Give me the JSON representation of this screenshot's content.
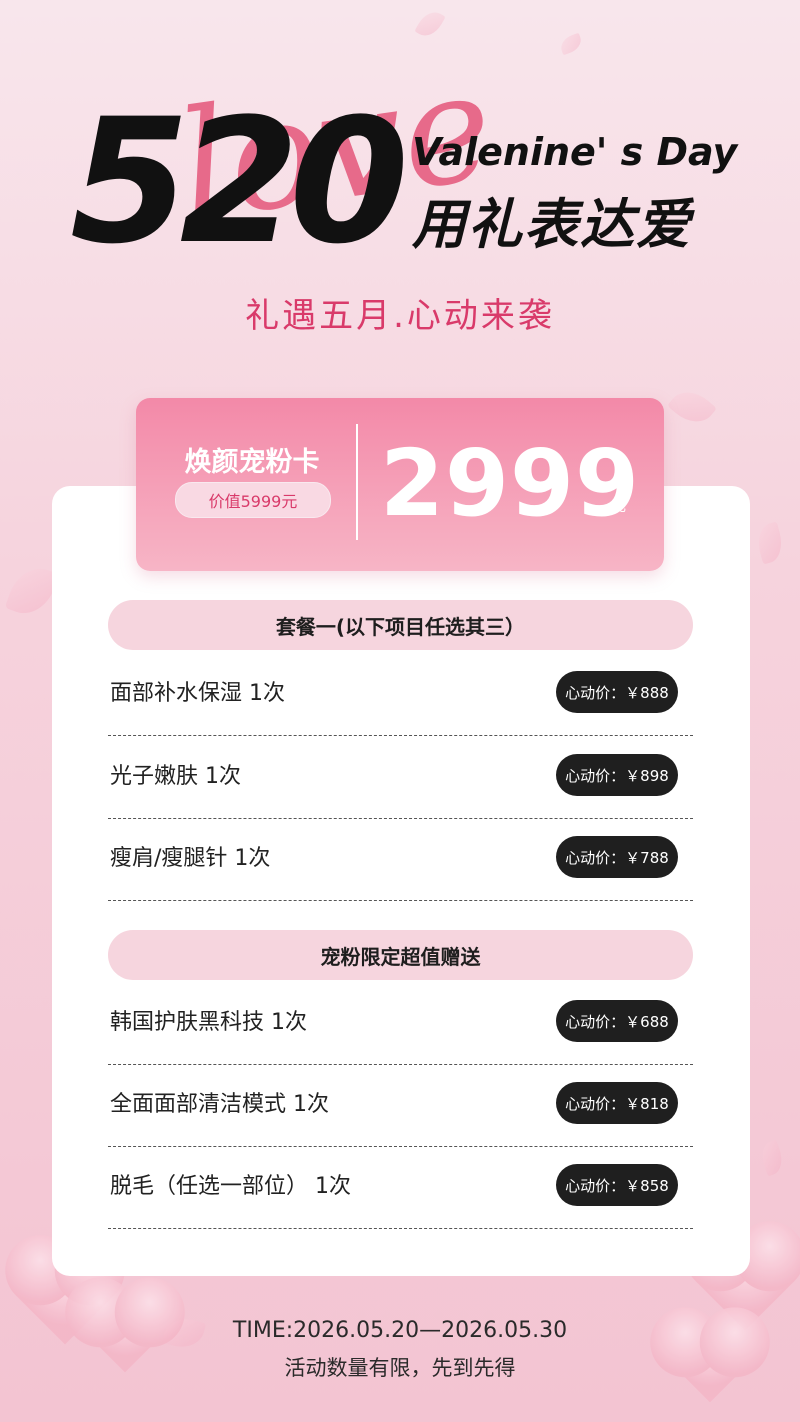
{
  "header": {
    "big_number": "520",
    "script_text": "love",
    "english": "Valenine' s Day",
    "chinese": "用礼表达爱",
    "subtitle": "礼遇五月.心动来袭"
  },
  "card": {
    "name": "焕颜宠粉卡",
    "worth": "价值5999元",
    "price": "2999",
    "unit": "元"
  },
  "packages": [
    {
      "title": "套餐一(以下项目任选其三）",
      "items": [
        {
          "label": "面部补水保湿  1次",
          "price": "心动价：￥888"
        },
        {
          "label": "光子嫩肤  1次",
          "price": "心动价：￥898"
        },
        {
          "label": "瘦肩/瘦腿针  1次",
          "price": "心动价：￥788"
        }
      ]
    },
    {
      "title": "宠粉限定超值赠送",
      "items": [
        {
          "label": "韩国护肤黑科技  1次",
          "price": "心动价：￥688"
        },
        {
          "label": "全面面部清洁模式  1次",
          "price": "心动价：￥818"
        },
        {
          "label": "脱毛（任选一部位）  1次",
          "price": "心动价：￥858"
        }
      ]
    }
  ],
  "footer": {
    "time": "TIME:2026.05.20—2026.05.30",
    "note": "活动数量有限，先到先得"
  },
  "colors": {
    "accent": "#d93a6a",
    "pill": "#1f1f1f",
    "section_bg": "#f6d5de"
  }
}
